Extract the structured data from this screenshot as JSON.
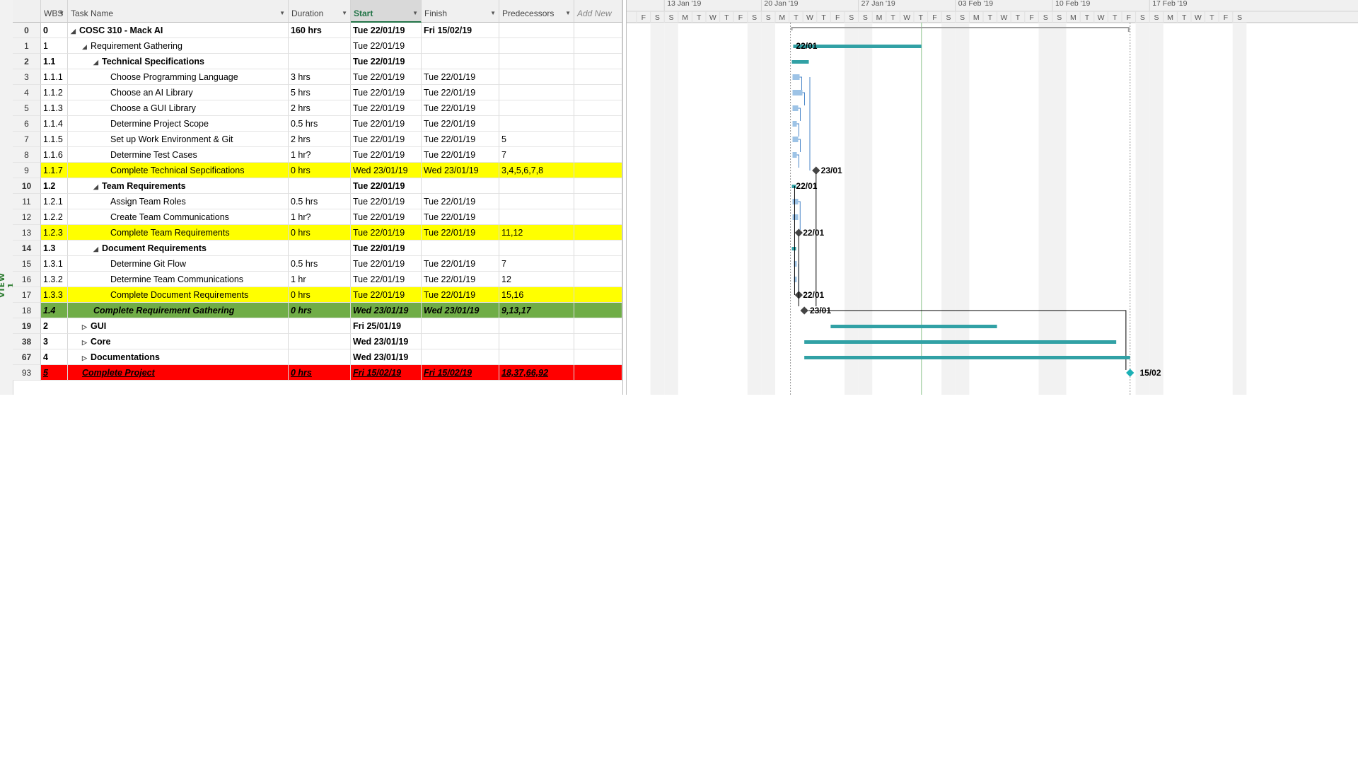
{
  "view_label": "VIEW 1",
  "columns": {
    "wbs": "WBS",
    "task_name": "Task Name",
    "duration": "Duration",
    "start": "Start",
    "finish": "Finish",
    "predecessors": "Predecessors",
    "add_new": "Add New"
  },
  "rows": [
    {
      "id": "0",
      "wbs": "0",
      "name": "COSC 310 - Mack AI",
      "level": 0,
      "toggle": "collapse",
      "duration": "160 hrs",
      "start": "Tue 22/01/19",
      "finish": "Fri 15/02/19",
      "pred": "",
      "style": "bold"
    },
    {
      "id": "1",
      "wbs": "1",
      "name": "Requirement Gathering",
      "level": 1,
      "toggle": "collapse",
      "duration": "",
      "start": "Tue 22/01/19",
      "finish": "",
      "pred": "",
      "style": ""
    },
    {
      "id": "2",
      "wbs": "1.1",
      "name": "Technical Specifications",
      "level": 2,
      "toggle": "collapse",
      "duration": "",
      "start": "Tue 22/01/19",
      "finish": "",
      "pred": "",
      "style": "bold"
    },
    {
      "id": "3",
      "wbs": "1.1.1",
      "name": "Choose Programming Language",
      "level": 3,
      "toggle": "",
      "duration": "3 hrs",
      "start": "Tue 22/01/19",
      "finish": "Tue 22/01/19",
      "pred": "",
      "style": ""
    },
    {
      "id": "4",
      "wbs": "1.1.2",
      "name": "Choose an AI Library",
      "level": 3,
      "toggle": "",
      "duration": "5 hrs",
      "start": "Tue 22/01/19",
      "finish": "Tue 22/01/19",
      "pred": "",
      "style": ""
    },
    {
      "id": "5",
      "wbs": "1.1.3",
      "name": "Choose a GUI Library",
      "level": 3,
      "toggle": "",
      "duration": "2 hrs",
      "start": "Tue 22/01/19",
      "finish": "Tue 22/01/19",
      "pred": "",
      "style": ""
    },
    {
      "id": "6",
      "wbs": "1.1.4",
      "name": "Determine Project Scope",
      "level": 3,
      "toggle": "",
      "duration": "0.5 hrs",
      "start": "Tue 22/01/19",
      "finish": "Tue 22/01/19",
      "pred": "",
      "style": ""
    },
    {
      "id": "7",
      "wbs": "1.1.5",
      "name": "Set up Work Environment & Git",
      "level": 3,
      "toggle": "",
      "duration": "2 hrs",
      "start": "Tue 22/01/19",
      "finish": "Tue 22/01/19",
      "pred": "5",
      "style": ""
    },
    {
      "id": "8",
      "wbs": "1.1.6",
      "name": "Determine Test Cases",
      "level": 3,
      "toggle": "",
      "duration": "1 hr?",
      "start": "Tue 22/01/19",
      "finish": "Tue 22/01/19",
      "pred": "7",
      "style": ""
    },
    {
      "id": "9",
      "wbs": "1.1.7",
      "name": "Complete Technical Sepcifications",
      "level": 3,
      "toggle": "",
      "duration": "0 hrs",
      "start": "Wed 23/01/19",
      "finish": "Wed 23/01/19",
      "pred": "3,4,5,6,7,8",
      "style": "yellow"
    },
    {
      "id": "10",
      "wbs": "1.2",
      "name": "Team Requirements",
      "level": 2,
      "toggle": "collapse",
      "duration": "",
      "start": "Tue 22/01/19",
      "finish": "",
      "pred": "",
      "style": "bold"
    },
    {
      "id": "11",
      "wbs": "1.2.1",
      "name": "Assign Team Roles",
      "level": 3,
      "toggle": "",
      "duration": "0.5 hrs",
      "start": "Tue 22/01/19",
      "finish": "Tue 22/01/19",
      "pred": "",
      "style": ""
    },
    {
      "id": "12",
      "wbs": "1.2.2",
      "name": "Create Team Communications",
      "level": 3,
      "toggle": "",
      "duration": "1 hr?",
      "start": "Tue 22/01/19",
      "finish": "Tue 22/01/19",
      "pred": "",
      "style": ""
    },
    {
      "id": "13",
      "wbs": "1.2.3",
      "name": "Complete Team Requirements",
      "level": 3,
      "toggle": "",
      "duration": "0 hrs",
      "start": "Tue 22/01/19",
      "finish": "Tue 22/01/19",
      "pred": "11,12",
      "style": "yellow"
    },
    {
      "id": "14",
      "wbs": "1.3",
      "name": "Document Requirements",
      "level": 2,
      "toggle": "collapse",
      "duration": "",
      "start": "Tue 22/01/19",
      "finish": "",
      "pred": "",
      "style": "bold"
    },
    {
      "id": "15",
      "wbs": "1.3.1",
      "name": "Determine Git Flow",
      "level": 3,
      "toggle": "",
      "duration": "0.5 hrs",
      "start": "Tue 22/01/19",
      "finish": "Tue 22/01/19",
      "pred": "7",
      "style": ""
    },
    {
      "id": "16",
      "wbs": "1.3.2",
      "name": "Determine Team Communications",
      "level": 3,
      "toggle": "",
      "duration": "1 hr",
      "start": "Tue 22/01/19",
      "finish": "Tue 22/01/19",
      "pred": "12",
      "style": ""
    },
    {
      "id": "17",
      "wbs": "1.3.3",
      "name": "Complete Document Requirements",
      "level": 3,
      "toggle": "",
      "duration": "0 hrs",
      "start": "Tue 22/01/19",
      "finish": "Tue 22/01/19",
      "pred": "15,16",
      "style": "yellow"
    },
    {
      "id": "18",
      "wbs": "1.4",
      "name": "Complete Requirement Gathering",
      "level": 2,
      "toggle": "",
      "duration": "0 hrs",
      "start": "Wed 23/01/19",
      "finish": "Wed 23/01/19",
      "pred": "9,13,17",
      "style": "green"
    },
    {
      "id": "19",
      "wbs": "2",
      "name": "GUI",
      "level": 1,
      "toggle": "expand",
      "duration": "",
      "start": "Fri 25/01/19",
      "finish": "",
      "pred": "",
      "style": "bold"
    },
    {
      "id": "38",
      "wbs": "3",
      "name": "Core",
      "level": 1,
      "toggle": "expand",
      "duration": "",
      "start": "Wed 23/01/19",
      "finish": "",
      "pred": "",
      "style": "bold"
    },
    {
      "id": "67",
      "wbs": "4",
      "name": "Documentations",
      "level": 1,
      "toggle": "expand",
      "duration": "",
      "start": "Wed 23/01/19",
      "finish": "",
      "pred": "",
      "style": "bold"
    },
    {
      "id": "93",
      "wbs": "5",
      "name": "Complete Project",
      "level": 1,
      "toggle": "",
      "duration": "0 hrs",
      "start": "Fri 15/02/19",
      "finish": "Fri 15/02/19",
      "pred": "18,37,66,92",
      "style": "red"
    }
  ],
  "timeline": {
    "weeks": [
      "13 Jan '19",
      "20 Jan '19",
      "27 Jan '19",
      "03 Feb '19",
      "10 Feb '19",
      "17 Feb '19"
    ],
    "lead_days": [
      "F",
      "S"
    ],
    "day_letters": [
      "S",
      "M",
      "T",
      "W",
      "T",
      "F",
      "S"
    ],
    "bar_color": "#31a1a5",
    "subtask_color": "#9dc3e6",
    "link_color": "#4a86c8",
    "status_line_color": "#9ccc9c"
  },
  "gantt_labels": [
    {
      "row": 1,
      "text": "22/01"
    },
    {
      "row": 9,
      "text": "23/01"
    },
    {
      "row": 10,
      "text": "22/01"
    },
    {
      "row": 13,
      "text": "22/01"
    },
    {
      "row": 17,
      "text": "22/01"
    },
    {
      "row": 18,
      "text": "23/01"
    },
    {
      "row": 22,
      "text": "15/02"
    }
  ]
}
